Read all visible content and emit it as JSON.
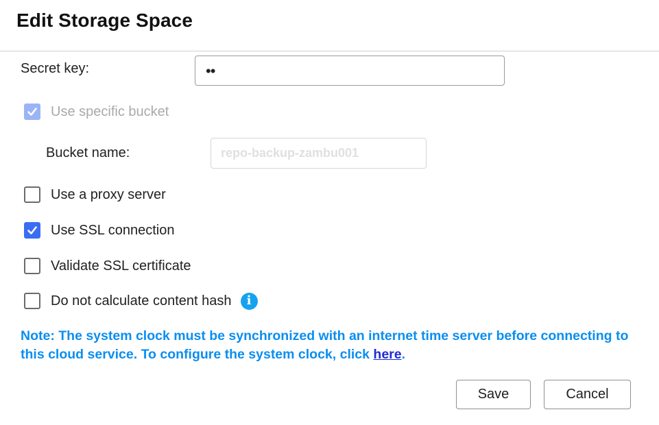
{
  "dialog": {
    "title": "Edit Storage Space"
  },
  "secret_key": {
    "label": "Secret key:",
    "masked_value": "••"
  },
  "specific_bucket": {
    "label": "Use specific bucket",
    "checked": true,
    "disabled": true
  },
  "bucket_name": {
    "label": "Bucket name:",
    "value": "repo-backup-zambu001"
  },
  "options": [
    {
      "label": "Use a proxy server",
      "checked": false
    },
    {
      "label": "Use SSL connection",
      "checked": true
    },
    {
      "label": "Validate SSL certificate",
      "checked": false
    },
    {
      "label": "Do not calculate content hash",
      "checked": false,
      "icon": "info-icon"
    }
  ],
  "note": {
    "text_before": "Note: The system clock must be synchronized with an internet time server before connecting to this cloud service. To configure the system clock, click ",
    "link_text": "here",
    "text_after": "."
  },
  "buttons": {
    "save": "Save",
    "cancel": "Cancel"
  },
  "colors": {
    "accent": "#3b6df2",
    "note": "#0a8ef0",
    "link": "#1d2bd6",
    "info": "#17a2f0"
  }
}
